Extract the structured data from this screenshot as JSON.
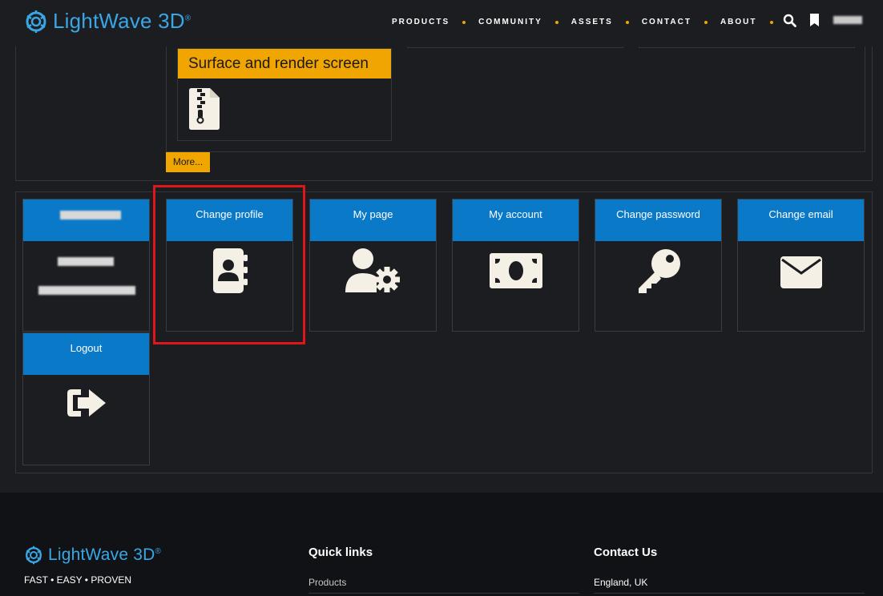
{
  "header": {
    "logo_text": "LightWave 3D",
    "logo_reg": "®",
    "nav": [
      "PRODUCTS",
      "COMMUNITY",
      "ASSETS",
      "CONTACT",
      "ABOUT"
    ]
  },
  "upper": {
    "file_card_title": "Surface and render screen",
    "more_label": "More..."
  },
  "tiles": {
    "change_profile": "Change profile",
    "my_page": "My page",
    "my_account": "My account",
    "change_password": "Change password",
    "change_email": "Change email",
    "logout": "Logout"
  },
  "footer": {
    "logo_text": "LightWave 3D",
    "logo_reg": "®",
    "tagline": "FAST • EASY • PROVEN",
    "quick_links_heading": "Quick links",
    "quick_link_1": "Products",
    "contact_heading": "Contact Us",
    "contact_line_1": "England, UK"
  },
  "colors": {
    "accent_yellow": "#f0a500",
    "tile_blue": "#0a79c8",
    "highlight_red": "#e0161c",
    "logo_blue": "#3aa6e6"
  }
}
